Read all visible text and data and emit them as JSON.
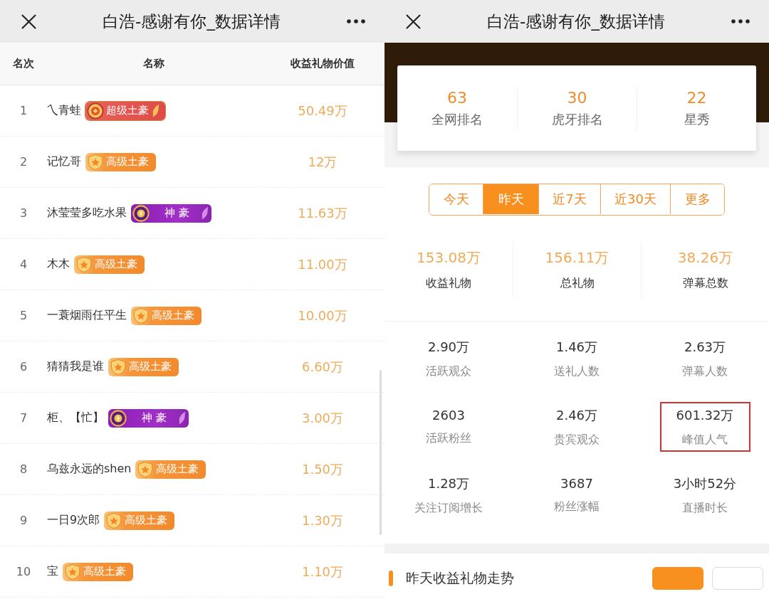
{
  "left_screen": {
    "title": "白浩-感谢有你_数据详情",
    "table": {
      "columns": [
        "名次",
        "名称",
        "收益礼物价值"
      ],
      "rows": [
        {
          "rank": "1",
          "name": "乀青蛙",
          "badge": {
            "kind": "super",
            "label": "超级土豪"
          },
          "value": "50.49万"
        },
        {
          "rank": "2",
          "name": "记忆哥",
          "badge": {
            "kind": "senior",
            "label": "高级土豪"
          },
          "value": "12万"
        },
        {
          "rank": "3",
          "name": "沐莹莹多吃水果",
          "badge": {
            "kind": "god",
            "label": "神 豪"
          },
          "value": "11.63万"
        },
        {
          "rank": "4",
          "name": "木木",
          "badge": {
            "kind": "senior",
            "label": "高级土豪"
          },
          "value": "11.00万"
        },
        {
          "rank": "5",
          "name": "一蓑烟雨任平生",
          "badge": {
            "kind": "senior",
            "label": "高级土豪"
          },
          "value": "10.00万"
        },
        {
          "rank": "6",
          "name": "猜猜我是谁",
          "badge": {
            "kind": "senior",
            "label": "高级土豪"
          },
          "value": "6.60万"
        },
        {
          "rank": "7",
          "name": "柜、【忙】",
          "badge": {
            "kind": "god",
            "label": "神 豪"
          },
          "value": "3.00万"
        },
        {
          "rank": "8",
          "name": "乌兹永远的shen",
          "badge": {
            "kind": "senior",
            "label": "高级土豪"
          },
          "value": "1.50万"
        },
        {
          "rank": "9",
          "name": "一日9次郎",
          "badge": {
            "kind": "senior",
            "label": "高级土豪"
          },
          "value": "1.30万"
        },
        {
          "rank": "10",
          "name": "宝",
          "badge": {
            "kind": "senior",
            "label": "高级土豪"
          },
          "value": "1.10万"
        }
      ]
    }
  },
  "right_screen": {
    "title": "白浩-感谢有你_数据详情",
    "rankings": [
      {
        "value": "63",
        "label": "全网排名"
      },
      {
        "value": "30",
        "label": "虎牙排名"
      },
      {
        "value": "22",
        "label": "星秀"
      }
    ],
    "period_tabs": [
      {
        "label": "今天",
        "selected": false
      },
      {
        "label": "昨天",
        "selected": true
      },
      {
        "label": "近7天",
        "selected": false
      },
      {
        "label": "近30天",
        "selected": false
      },
      {
        "label": "更多",
        "selected": false
      }
    ],
    "totals": [
      {
        "value": "153.08万",
        "label": "收益礼物"
      },
      {
        "value": "156.11万",
        "label": "总礼物"
      },
      {
        "value": "38.26万",
        "label": "弹幕总数"
      }
    ],
    "stats": [
      {
        "value": "2.90万",
        "label": "活跃观众",
        "highlighted": false
      },
      {
        "value": "1.46万",
        "label": "送礼人数",
        "highlighted": false
      },
      {
        "value": "2.63万",
        "label": "弹幕人数",
        "highlighted": false
      },
      {
        "value": "2603",
        "label": "活跃粉丝",
        "highlighted": false
      },
      {
        "value": "2.46万",
        "label": "贵宾观众",
        "highlighted": false
      },
      {
        "value": "601.32万",
        "label": "峰值人气",
        "highlighted": true
      },
      {
        "value": "1.28万",
        "label": "关注订阅增长",
        "highlighted": false
      },
      {
        "value": "3687",
        "label": "粉丝涨幅",
        "highlighted": false
      },
      {
        "value": "3小时52分",
        "label": "直播时长",
        "highlighted": false
      }
    ],
    "section": {
      "title": "昨天收益礼物走势",
      "toggles": [
        {
          "selected": true
        },
        {
          "selected": false
        }
      ]
    }
  }
}
